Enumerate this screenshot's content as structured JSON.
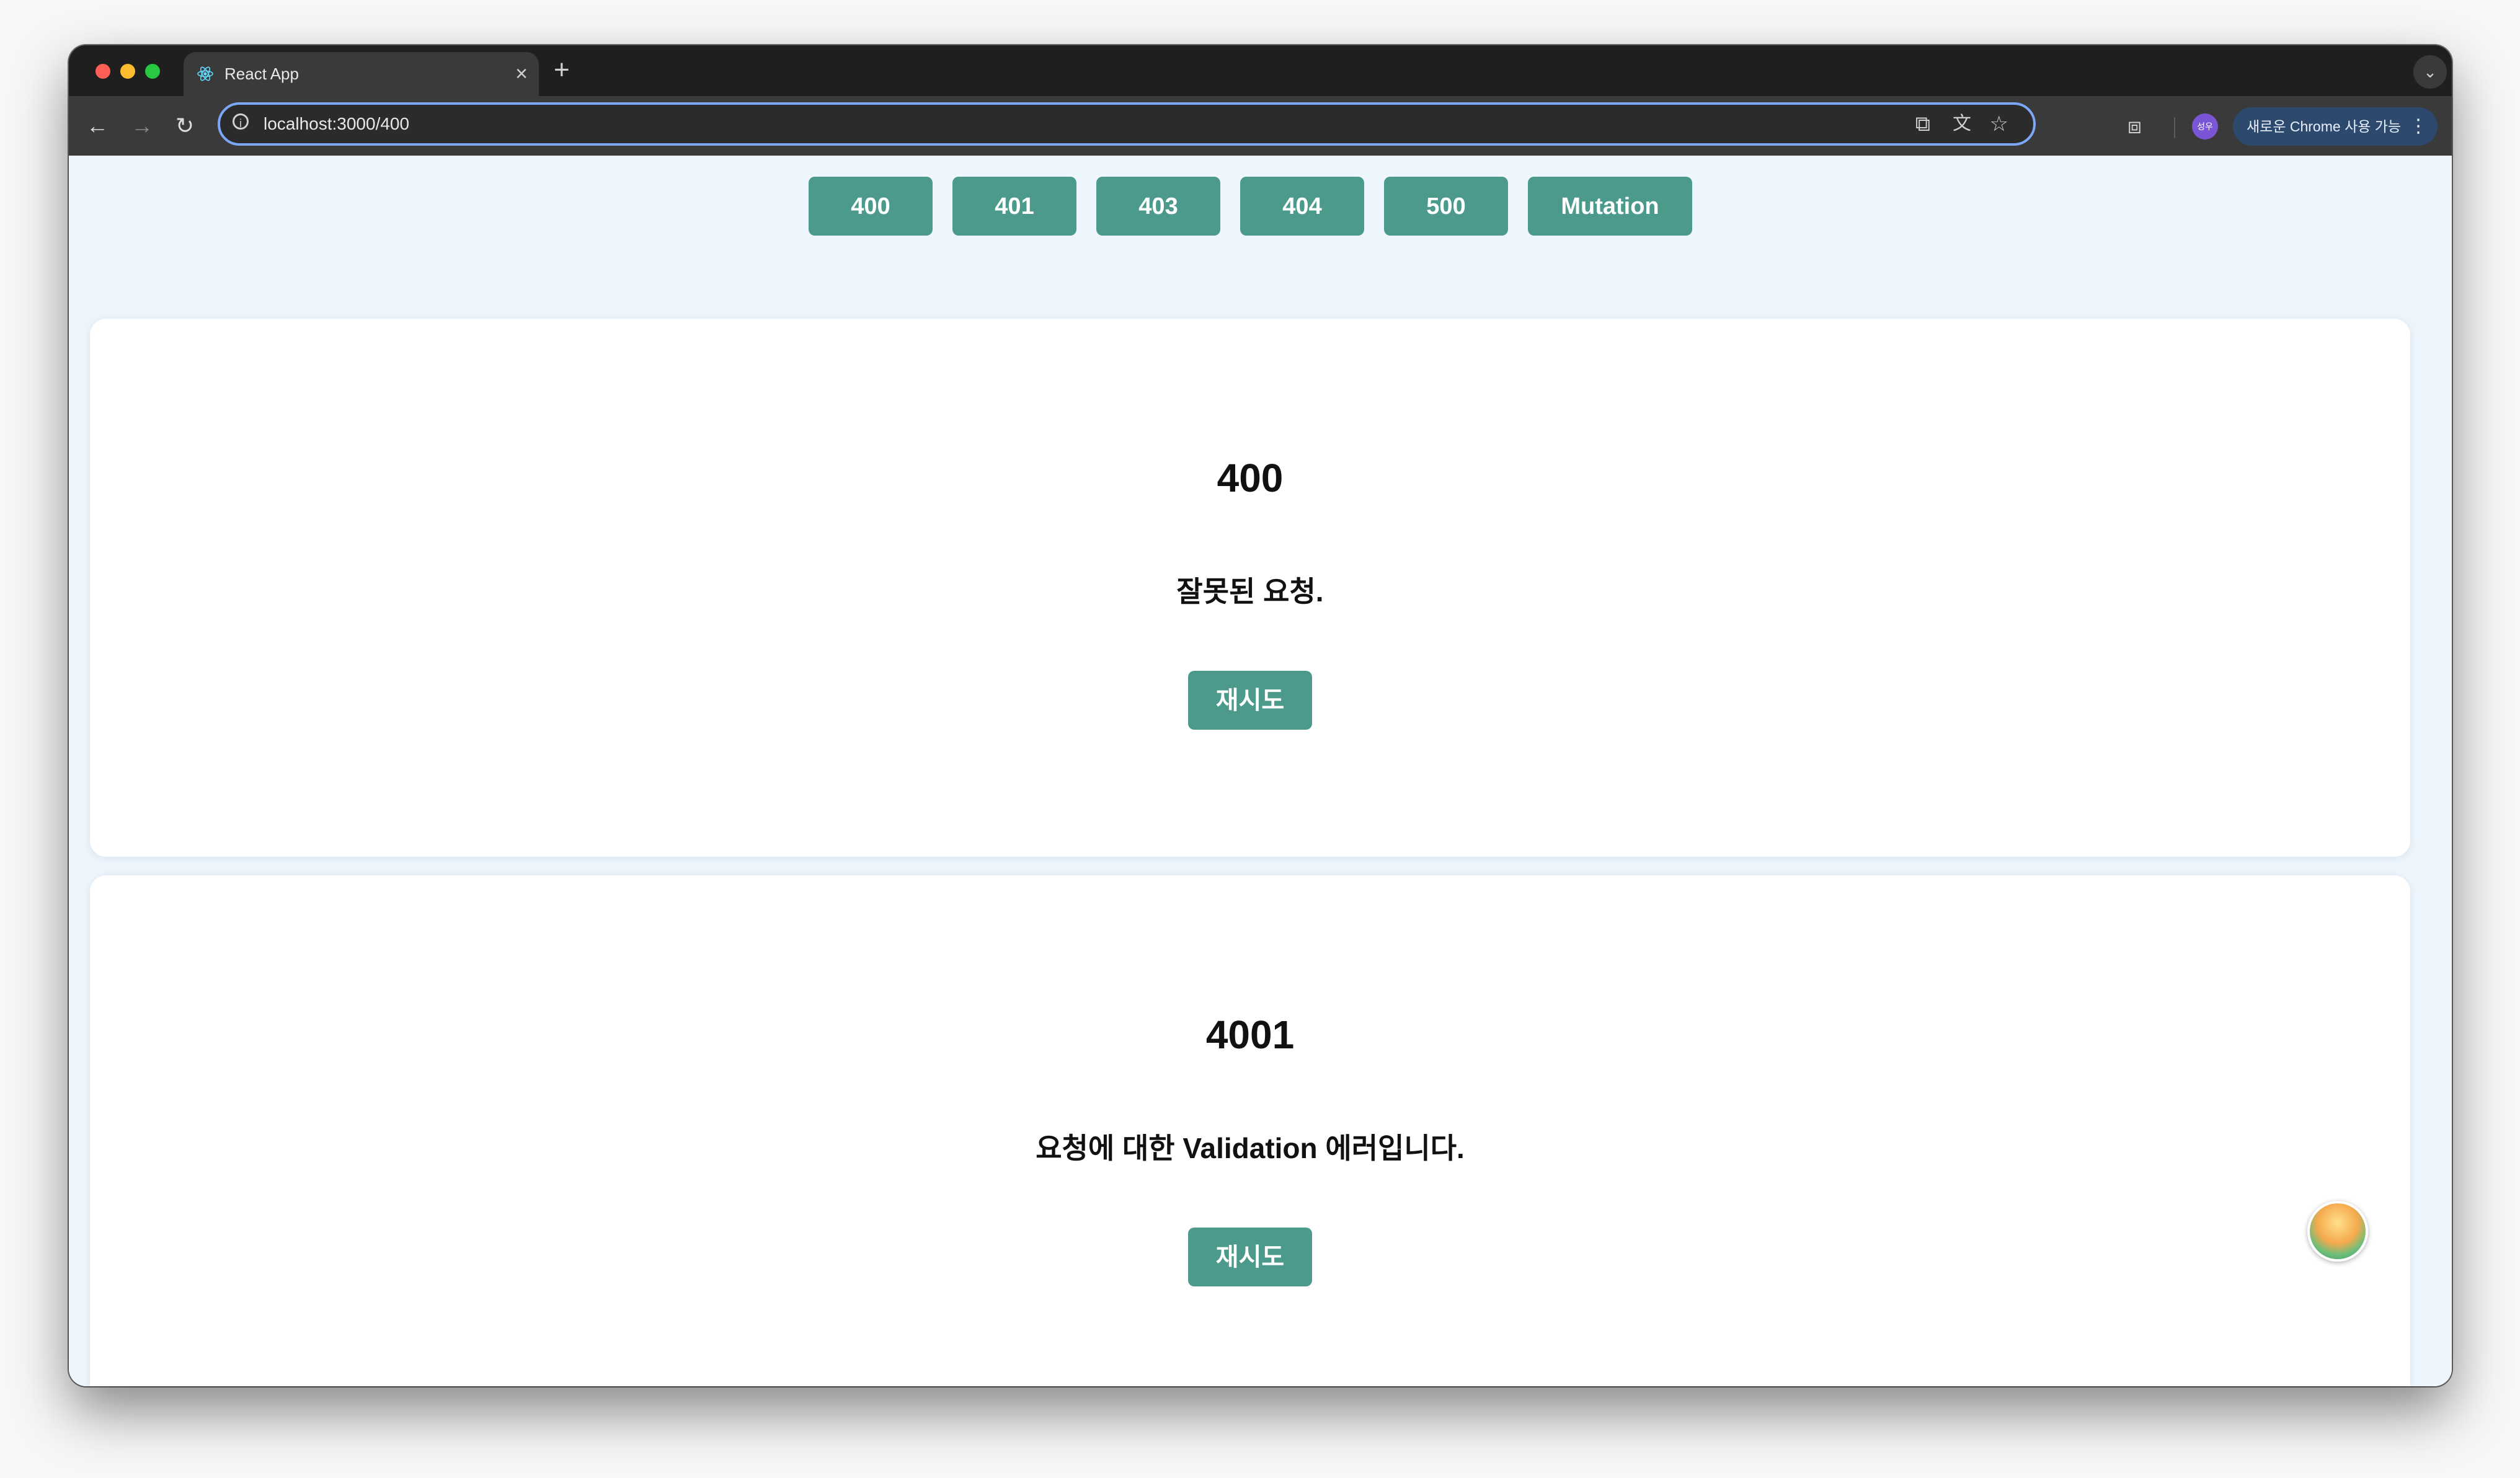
{
  "browser": {
    "tab": {
      "title": "React App",
      "close_glyph": "×"
    },
    "new_tab_glyph": "+",
    "tabs_menu_glyph": "⌄",
    "url": "localhost:3000/400",
    "avatar_label": "성우",
    "update_label": "새로운 Chrome 사용 가능",
    "icons": [
      "back-icon",
      "forward-icon",
      "reload-icon",
      "info-icon",
      "open-external-icon",
      "translate-icon",
      "star-icon",
      "extensions-icon",
      "menu-more-icon"
    ]
  },
  "nav_buttons": [
    "400",
    "401",
    "403",
    "404",
    "500",
    "Mutation"
  ],
  "cards": [
    {
      "code": "400",
      "message": "잘못된 요청.",
      "retry_label": "재시도"
    },
    {
      "code": "4001",
      "message": "요청에 대한 Validation 에러입니다.",
      "retry_label": "재시도"
    }
  ],
  "colors": {
    "accent": "#4c9a8b",
    "page_background": "#eef6fd",
    "omnibox_focus": "#7ca6f7"
  }
}
